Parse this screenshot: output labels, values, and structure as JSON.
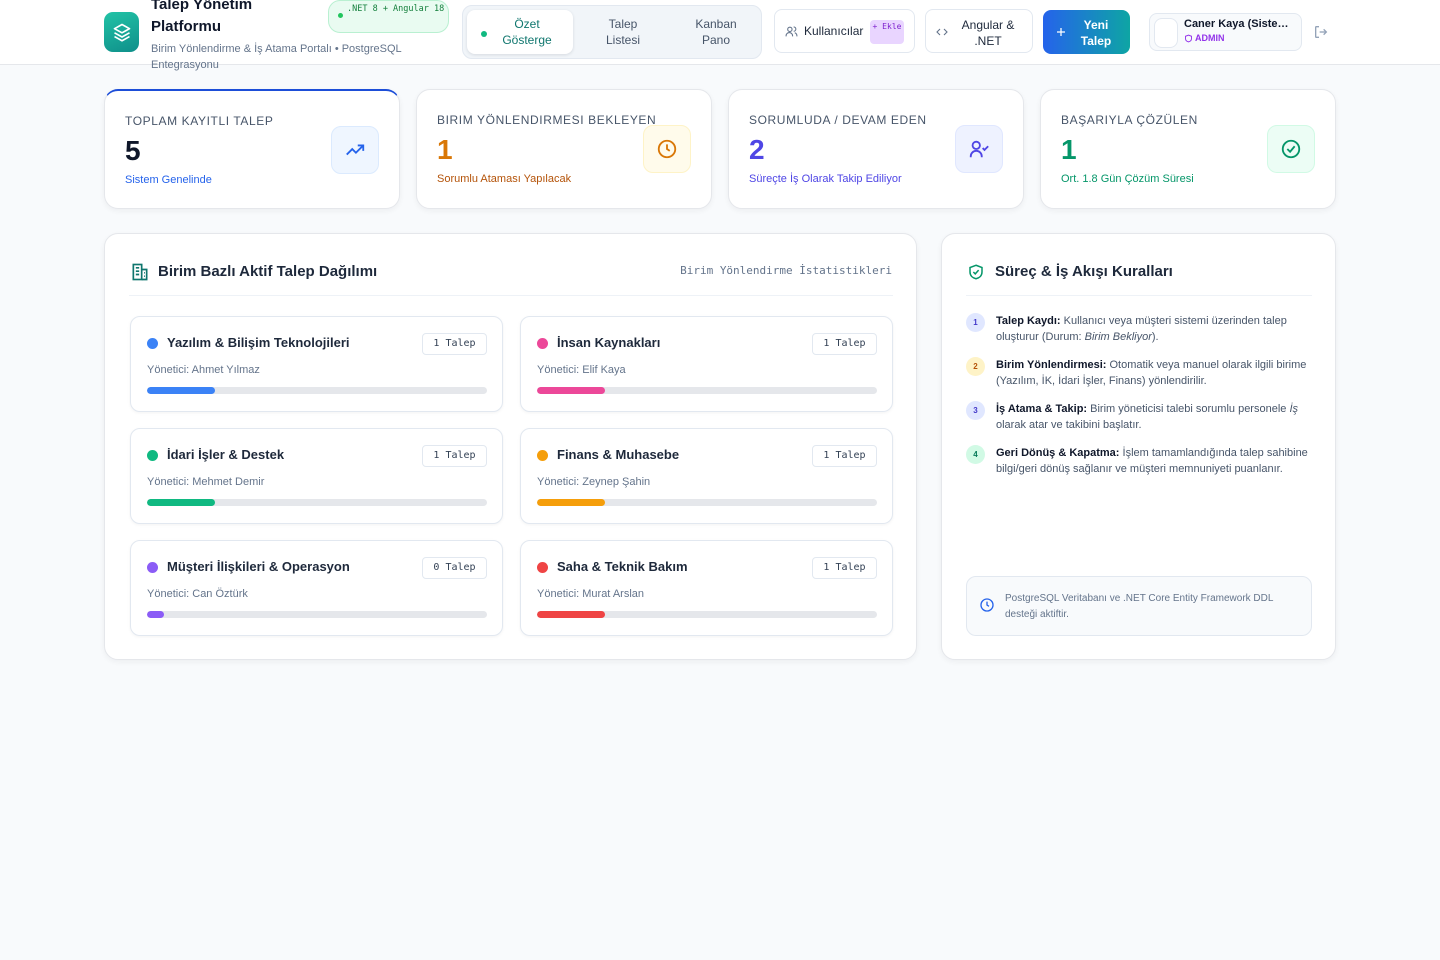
{
  "brand": {
    "title": "Talep Yönetim Platformu",
    "subtitle": "Birim Yönlendirme & İş Atama Portalı • PostgreSQL Entegrasyonu",
    "tech_badge": ".NET 8 + Angular 18"
  },
  "nav": {
    "tabs": [
      {
        "label": "Özet Gösterge",
        "active": true
      },
      {
        "label": "Talep Listesi",
        "active": false
      },
      {
        "label": "Kanban Pano",
        "active": false
      }
    ]
  },
  "header_actions": {
    "users_label": "Kullanıcılar",
    "users_add_label": "+ Ekle",
    "angular_label": "Angular & .NET",
    "new_request_label": "Yeni Talep",
    "user_name": "Caner Kaya (Sistem Yöneticisi)",
    "user_role": "ADMIN"
  },
  "stats": [
    {
      "label": "TOPLAM KAYITLI TALEP",
      "value": "5",
      "foot": "Sistem Genelinde",
      "color": "#0f172a",
      "foot_color": "#2563eb",
      "icon": "trending-up-icon"
    },
    {
      "label": "BIRIM YÖNLENDIRMESI BEKLEYEN",
      "value": "1",
      "foot": "Sorumlu Ataması Yapılacak",
      "color": "#d97706",
      "foot_color": "#b45309",
      "icon": "clock-icon"
    },
    {
      "label": "SORUMLUDA / DEVAM EDEN",
      "value": "2",
      "foot": "Süreçte İş Olarak Takip Ediliyor",
      "color": "#4f46e5",
      "foot_color": "#4f46e5",
      "icon": "user-check-icon"
    },
    {
      "label": "BAŞARIYLA ÇÖZÜLEN",
      "value": "1",
      "foot": "Ort. 1.8 Gün Çözüm Süresi",
      "color": "#059669",
      "foot_color": "#059669",
      "icon": "check-circle-icon"
    }
  ],
  "distribution": {
    "title": "Birim Bazlı Aktif Talep Dağılımı",
    "subtitle": "Birim Yönlendirme İstatistikleri",
    "manager_prefix": "Yönetici:",
    "departments": [
      {
        "name": "Yazılım & Bilişim Teknolojileri",
        "count": "1 Talep",
        "manager": "Yönetici: Ahmet Yılmaz",
        "color": "#3b82f6",
        "fill": 0.2
      },
      {
        "name": "İnsan Kaynakları",
        "count": "1 Talep",
        "manager": "Yönetici: Elif Kaya",
        "color": "#ec4899",
        "fill": 0.2
      },
      {
        "name": "İdari İşler & Destek",
        "count": "1 Talep",
        "manager": "Yönetici: Mehmet Demir",
        "color": "#10b981",
        "fill": 0.2
      },
      {
        "name": "Finans & Muhasebe",
        "count": "1 Talep",
        "manager": "Yönetici: Zeynep Şahin",
        "color": "#f59e0b",
        "fill": 0.2
      },
      {
        "name": "Müşteri İlişkileri & Operasyon",
        "count": "0 Talep",
        "manager": "Yönetici: Can Öztürk",
        "color": "#8b5cf6",
        "fill": 0.05
      },
      {
        "name": "Saha & Teknik Bakım",
        "count": "1 Talep",
        "manager": "Yönetici: Murat Arslan",
        "color": "#ef4444",
        "fill": 0.2
      }
    ]
  },
  "rules": {
    "title": "Süreç & İş Akışı Kuralları",
    "items": [
      {
        "num": "1",
        "bold": "Talep Kaydı:",
        "text": " Kullanıcı veya müşteri sistemi üzerinden talep oluşturur (Durum: ",
        "italic": "Birim Bekliyor",
        "tail": ").",
        "bg": "#e0e7ff",
        "fg": "#4338ca"
      },
      {
        "num": "2",
        "bold": "Birim Yönlendirmesi:",
        "text": " Otomatik veya manuel olarak ilgili birime (Yazılım, İK, İdari İşler, Finans) yönlendirilir.",
        "italic": "",
        "tail": "",
        "bg": "#fef3c7",
        "fg": "#b45309"
      },
      {
        "num": "3",
        "bold": "İş Atama & Takip:",
        "text": " Birim yöneticisi talebi sorumlu personele ",
        "italic": "İş",
        "tail": " olarak atar ve takibini başlatır.",
        "bg": "#e0e7ff",
        "fg": "#4338ca"
      },
      {
        "num": "4",
        "bold": "Geri Dönüş & Kapatma:",
        "text": " İşlem tamamlandığında talep sahibine bilgi/geri dönüş sağlanır ve müşteri memnuniyeti puanlanır.",
        "italic": "",
        "tail": "",
        "bg": "#d1fae5",
        "fg": "#047857"
      }
    ],
    "info": "PostgreSQL Veritabanı ve .NET Core Entity Framework DDL desteği aktiftir."
  }
}
